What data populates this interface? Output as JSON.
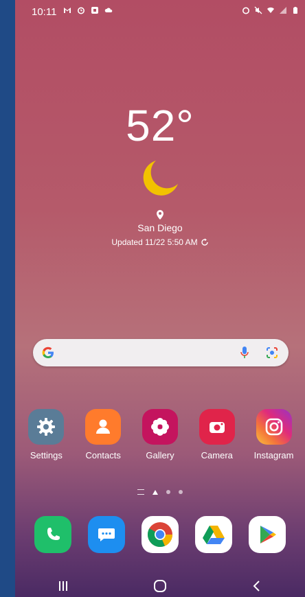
{
  "status_bar": {
    "time": "10:11"
  },
  "weather": {
    "temperature": "52°",
    "condition_icon": "moon-icon",
    "city": "San Diego",
    "updated": "Updated 11/22 5:50 AM"
  },
  "search": {
    "brand_icon": "google-icon",
    "mic_icon": "mic-icon",
    "lens_icon": "lens-icon"
  },
  "apps": [
    {
      "label": "Settings",
      "icon": "gear-icon"
    },
    {
      "label": "Contacts",
      "icon": "person-icon"
    },
    {
      "label": "Gallery",
      "icon": "flower-icon"
    },
    {
      "label": "Camera",
      "icon": "camera-icon"
    },
    {
      "label": "Instagram",
      "icon": "instagram-icon"
    }
  ],
  "dock": [
    {
      "name": "phone",
      "icon": "phone-icon"
    },
    {
      "name": "messages",
      "icon": "chat-icon"
    },
    {
      "name": "chrome",
      "icon": "chrome-icon"
    },
    {
      "name": "drive",
      "icon": "drive-icon"
    },
    {
      "name": "play store",
      "icon": "play-store-icon"
    }
  ],
  "colors": {
    "accent_moon": "#f2c200",
    "settings": "#5a7c97",
    "contacts": "#ff7b2c",
    "gallery": "#c4145e",
    "camera": "#e0244a"
  }
}
